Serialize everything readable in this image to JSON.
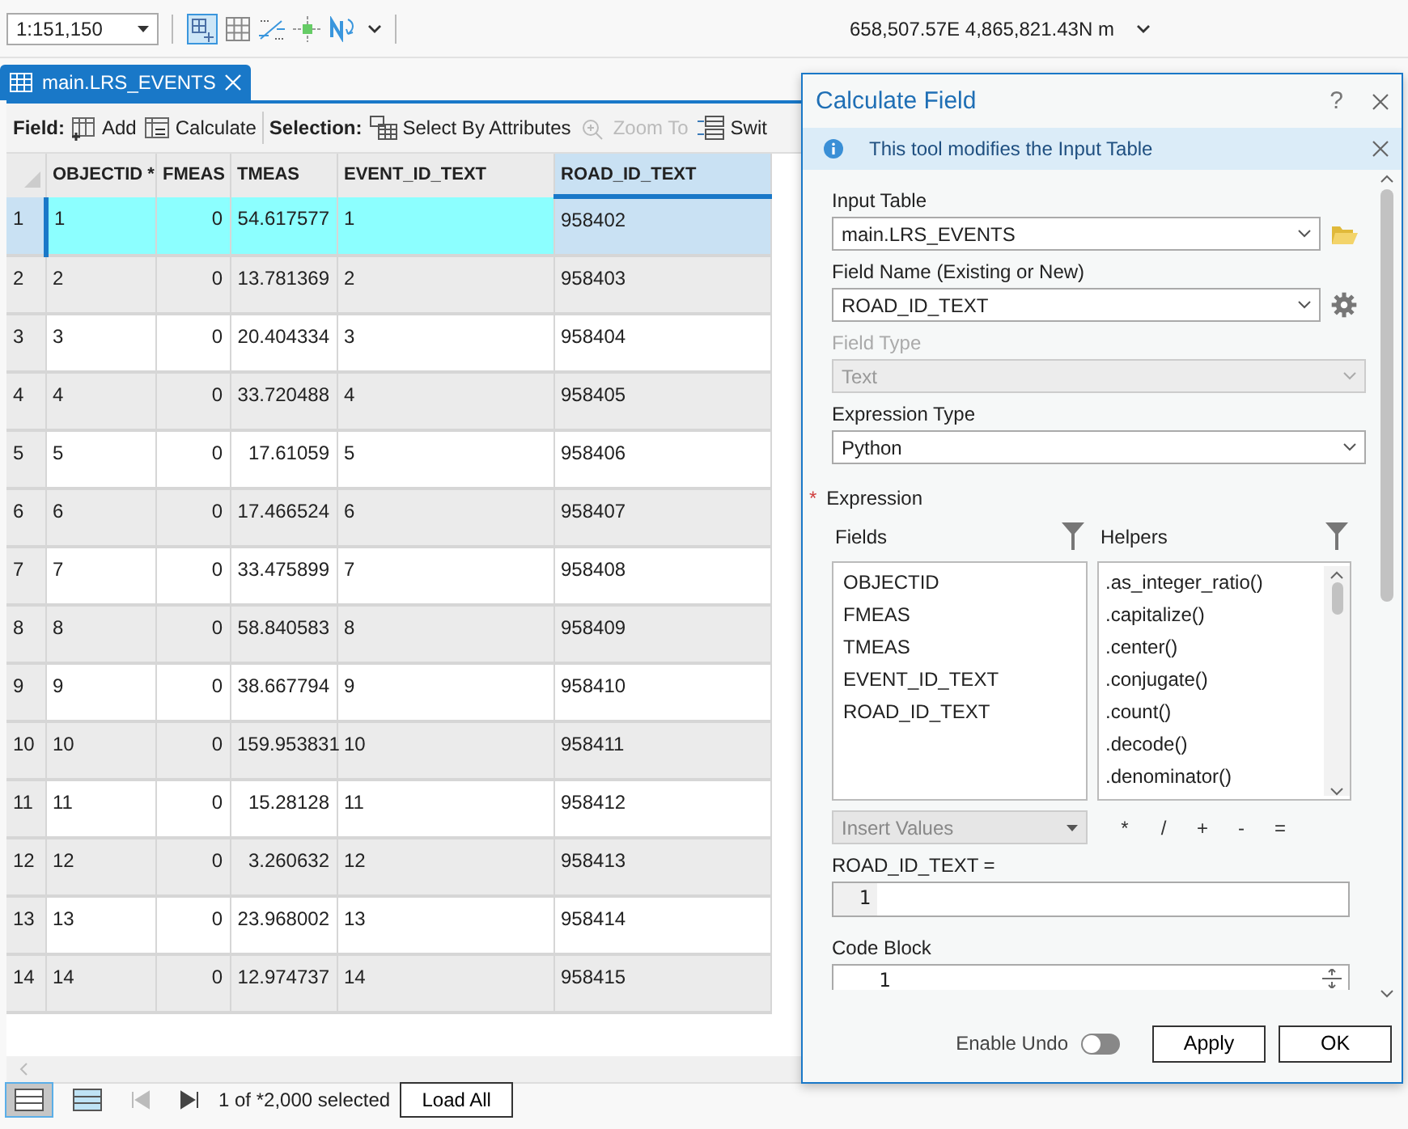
{
  "map_toolbar": {
    "scale": "1:151,150",
    "coordinates": "658,507.57E 4,865,821.43N m"
  },
  "tab": {
    "label": "main.LRS_EVENTS",
    "selected": true
  },
  "field_toolbar": {
    "field_label": "Field:",
    "add": "Add",
    "calculate": "Calculate",
    "selection_label": "Selection:",
    "select_by_attributes": "Select By Attributes",
    "zoom_to": "Zoom To",
    "zoom_to_disabled": true,
    "switch": "Swit"
  },
  "table": {
    "columns": [
      "OBJECTID *",
      "FMEAS",
      "TMEAS",
      "EVENT_ID_TEXT",
      "ROAD_ID_TEXT"
    ],
    "rows": [
      {
        "n": "1",
        "cells": [
          "1",
          "0",
          "54.617577",
          "1",
          "958402"
        ],
        "selected": true
      },
      {
        "n": "2",
        "cells": [
          "2",
          "0",
          "13.781369",
          "2",
          "958403"
        ],
        "selected": false
      },
      {
        "n": "3",
        "cells": [
          "3",
          "0",
          "20.404334",
          "3",
          "958404"
        ],
        "selected": false
      },
      {
        "n": "4",
        "cells": [
          "4",
          "0",
          "33.720488",
          "4",
          "958405"
        ],
        "selected": false
      },
      {
        "n": "5",
        "cells": [
          "5",
          "0",
          "17.61059",
          "5",
          "958406"
        ],
        "selected": false
      },
      {
        "n": "6",
        "cells": [
          "6",
          "0",
          "17.466524",
          "6",
          "958407"
        ],
        "selected": false
      },
      {
        "n": "7",
        "cells": [
          "7",
          "0",
          "33.475899",
          "7",
          "958408"
        ],
        "selected": false
      },
      {
        "n": "8",
        "cells": [
          "8",
          "0",
          "58.840583",
          "8",
          "958409"
        ],
        "selected": false
      },
      {
        "n": "9",
        "cells": [
          "9",
          "0",
          "38.667794",
          "9",
          "958410"
        ],
        "selected": false
      },
      {
        "n": "10",
        "cells": [
          "10",
          "0",
          "159.953831",
          "10",
          "958411"
        ],
        "selected": false
      },
      {
        "n": "11",
        "cells": [
          "11",
          "0",
          "15.28128",
          "11",
          "958412"
        ],
        "selected": false
      },
      {
        "n": "12",
        "cells": [
          "12",
          "0",
          "3.260632",
          "12",
          "958413"
        ],
        "selected": false
      },
      {
        "n": "13",
        "cells": [
          "13",
          "0",
          "23.968002",
          "13",
          "958414"
        ],
        "selected": false
      },
      {
        "n": "14",
        "cells": [
          "14",
          "0",
          "12.974737",
          "14",
          "958415"
        ],
        "selected": false
      }
    ]
  },
  "status_bar": {
    "views": [
      {
        "selected": true
      },
      {
        "selected": false
      }
    ],
    "count": "1 of *2,000 selected",
    "load_all": "Load All"
  },
  "dialog": {
    "title": "Calculate Field",
    "help": "?",
    "info": "This tool modifies the Input Table",
    "input_table": {
      "label": "Input Table",
      "value": "main.LRS_EVENTS"
    },
    "field_name": {
      "label": "Field Name (Existing or New)",
      "value": "ROAD_ID_TEXT"
    },
    "field_type": {
      "label": "Field Type",
      "value": "Text",
      "disabled": true
    },
    "expression_type": {
      "label": "Expression Type",
      "value": "Python"
    },
    "expression": {
      "required_mark": "*",
      "label": "Expression",
      "fields_label": "Fields",
      "helpers_label": "Helpers",
      "fields": [
        "OBJECTID",
        "FMEAS",
        "TMEAS",
        "EVENT_ID_TEXT",
        "ROAD_ID_TEXT"
      ],
      "helpers": [
        ".as_integer_ratio()",
        ".capitalize()",
        ".center()",
        ".conjugate()",
        ".count()",
        ".decode()",
        ".denominator()"
      ],
      "insert_values": "Insert Values",
      "operators": [
        "*",
        "/",
        "+",
        "-",
        "="
      ],
      "target": "ROAD_ID_TEXT =",
      "line_number": "1"
    },
    "code_block": {
      "label": "Code Block",
      "line_number": "1"
    },
    "enable_undo": {
      "label": "Enable Undo",
      "on": false
    },
    "buttons": [
      "Apply",
      "OK"
    ]
  }
}
